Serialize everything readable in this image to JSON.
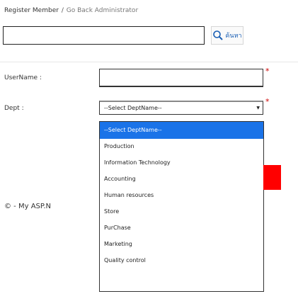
{
  "breadcrumb": {
    "current": "Register Member",
    "separator": "/",
    "back": "Go Back Administrator"
  },
  "search": {
    "value": "",
    "button_label": "ค้นหา",
    "button_icon": "magnifier-icon"
  },
  "form": {
    "username_label": "UserName :",
    "username_value": "",
    "required_mark": "*",
    "dept_label": "Dept :",
    "dept_selected": "--Select DeptName--",
    "dept_options": [
      "--Select DeptName--",
      "Production",
      "Information Technology",
      "Accounting",
      "Human resources",
      "Store",
      "PurChase",
      "Marketing",
      "Quality control"
    ]
  },
  "footer": {
    "text": "© - My ASP.N"
  },
  "colors": {
    "highlight": "#1a73e8",
    "required": "#cc0000",
    "accent_block": "#ff0000"
  }
}
